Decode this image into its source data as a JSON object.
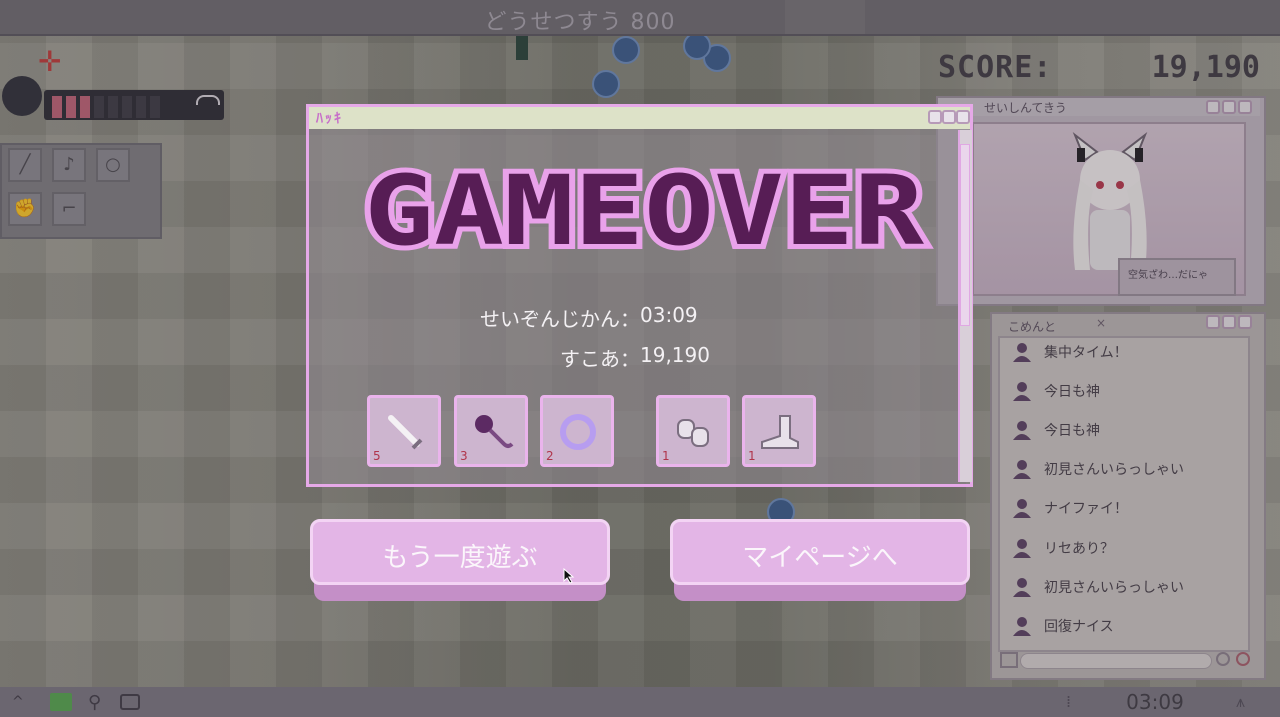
{
  "topbar": {
    "title": "どうせつすう 800"
  },
  "hud": {
    "score_label": "SCORE:",
    "score_value": "19,190",
    "hp_segments": 3,
    "hp_total": 10,
    "inventory_icons": [
      "sword-icon",
      "microphone-icon",
      "ring-icon",
      "gloves-icon",
      "boot-icon"
    ]
  },
  "stream": {
    "window_title": "せいしんてきう",
    "bubble_text": "空気ざわ…だにゃ"
  },
  "comments": {
    "window_title": "こめんと",
    "items": [
      "集中タイム！",
      "今日も神",
      "今日も神",
      "初見さんいらっしゃい",
      "ナイファイ！",
      "リセあり？",
      "初見さんいらっしゃい",
      "回復ナイス"
    ]
  },
  "dialog": {
    "title": "ﾊｯｷ",
    "headline": "GAMEOVER",
    "survival_label": "せいぞんじかん：",
    "survival_value": "03:09",
    "score_label": "すこあ：",
    "score_value": "19,190",
    "items": [
      {
        "icon": "sword-icon",
        "level": "5"
      },
      {
        "icon": "microphone-icon",
        "level": "3"
      },
      {
        "icon": "ring-icon",
        "level": "2"
      },
      {
        "icon": "gloves-icon",
        "level": "1"
      },
      {
        "icon": "boot-icon",
        "level": "1"
      }
    ]
  },
  "buttons": {
    "retry_label": "もう一度遊ぶ",
    "mypage_label": "マイページへ"
  },
  "bottombar": {
    "clock": "03:09"
  },
  "colors": {
    "accent": "#e3b5e6",
    "dark_purple": "#571d55",
    "hp_fill": "#c06078"
  }
}
